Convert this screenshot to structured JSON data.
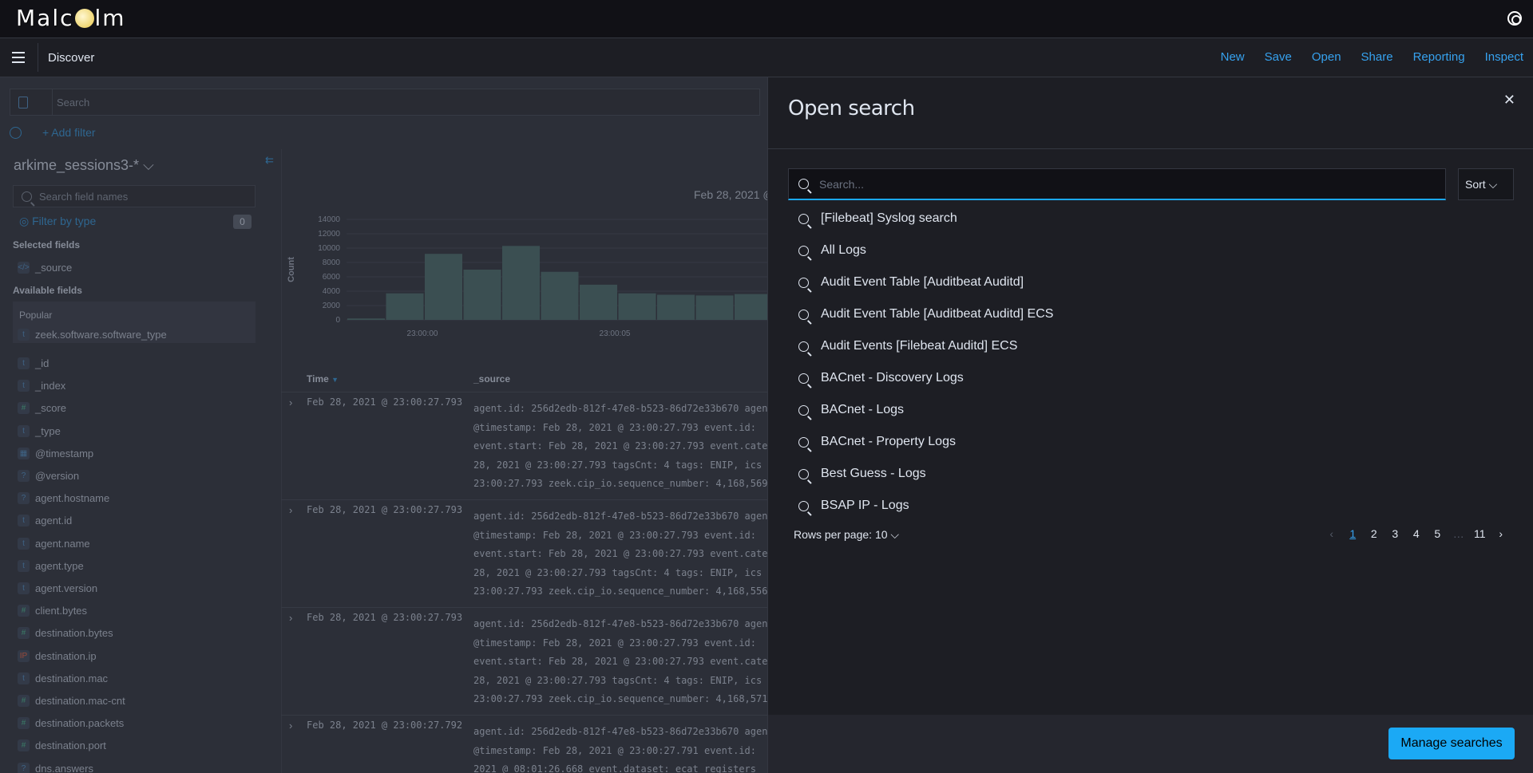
{
  "app": {
    "logo": "Malcolm",
    "breadcrumb": "Discover"
  },
  "toplinks": [
    "New",
    "Save",
    "Open",
    "Share",
    "Reporting",
    "Inspect"
  ],
  "discover": {
    "query_placeholder": "Search",
    "add_filter": "+ Add filter",
    "index_pattern": "arkime_sessions3-*",
    "field_search_placeholder": "Search field names",
    "filter_by_type": "Filter by type",
    "filter_count": "0",
    "selected_fields_label": "Selected fields",
    "selected_fields": [
      {
        "type": "</>",
        "name": "_source"
      }
    ],
    "available_fields_label": "Available fields",
    "popular_label": "Popular",
    "popular_fields": [
      {
        "type": "t",
        "name": "zeek.software.software_type"
      }
    ],
    "fields": [
      {
        "type": "t",
        "name": "_id"
      },
      {
        "type": "t",
        "name": "_index"
      },
      {
        "type": "#",
        "name": "_score"
      },
      {
        "type": "t",
        "name": "_type"
      },
      {
        "type": "▦",
        "name": "@timestamp"
      },
      {
        "type": "?",
        "name": "@version"
      },
      {
        "type": "?",
        "name": "agent.hostname"
      },
      {
        "type": "t",
        "name": "agent.id"
      },
      {
        "type": "t",
        "name": "agent.name"
      },
      {
        "type": "t",
        "name": "agent.type"
      },
      {
        "type": "t",
        "name": "agent.version"
      },
      {
        "type": "#",
        "name": "client.bytes"
      },
      {
        "type": "#",
        "name": "destination.bytes"
      },
      {
        "type": "IP",
        "name": "destination.ip"
      },
      {
        "type": "t",
        "name": "destination.mac"
      },
      {
        "type": "#",
        "name": "destination.mac-cnt"
      },
      {
        "type": "#",
        "name": "destination.packets"
      },
      {
        "type": "#",
        "name": "destination.port"
      },
      {
        "type": "?",
        "name": "dns.answers"
      }
    ],
    "histogram": {
      "date_label": "Feb 28, 2021 @",
      "ylabel": "Count",
      "yticks": [
        "14000",
        "12000",
        "10000",
        "8000",
        "6000",
        "4000",
        "2000",
        "0"
      ],
      "ymax": 14000,
      "xticks": [
        "23:00:00",
        "23:00:05"
      ],
      "values": [
        200,
        3700,
        9200,
        7000,
        10300,
        6700,
        4900,
        3700,
        3500,
        3400,
        3600
      ]
    },
    "table": {
      "columns": [
        "Time",
        "_source"
      ],
      "rows": [
        {
          "time": "Feb 28, 2021 @ 23:00:27.793",
          "lines": [
            "agent.id: 256d2edb-812f-47e8-b523-86d72e33b670  agent",
            "@timestamp: Feb 28, 2021 @ 23:00:27.793  event.id: ",
            "event.start: Feb 28, 2021 @ 23:00:27.793  event.cate",
            "28, 2021 @ 23:00:27.793  tagsCnt: 4  tags: ENIP, ics",
            "23:00:27.793  zeek.cip_io.sequence_number: 4,168,569"
          ]
        },
        {
          "time": "Feb 28, 2021 @ 23:00:27.793",
          "lines": [
            "agent.id: 256d2edb-812f-47e8-b523-86d72e33b670  agent",
            "@timestamp: Feb 28, 2021 @ 23:00:27.793  event.id: ",
            "event.start: Feb 28, 2021 @ 23:00:27.793  event.cate",
            "28, 2021 @ 23:00:27.793  tagsCnt: 4  tags: ENIP, ics",
            "23:00:27.793  zeek.cip_io.sequence_number: 4,168,556"
          ]
        },
        {
          "time": "Feb 28, 2021 @ 23:00:27.793",
          "lines": [
            "agent.id: 256d2edb-812f-47e8-b523-86d72e33b670  agent",
            "@timestamp: Feb 28, 2021 @ 23:00:27.793  event.id: ",
            "event.start: Feb 28, 2021 @ 23:00:27.793  event.cate",
            "28, 2021 @ 23:00:27.793  tagsCnt: 4  tags: ENIP, ics",
            "23:00:27.793  zeek.cip_io.sequence_number: 4,168,571"
          ]
        },
        {
          "time": "Feb 28, 2021 @ 23:00:27.792",
          "lines": [
            "agent.id: 256d2edb-812f-47e8-b523-86d72e33b670  agent",
            "@timestamp: Feb 28, 2021 @ 23:00:27.791  event.id: ",
            "2021 @ 08:01:26.668  event.dataset: ecat_registers"
          ]
        }
      ]
    }
  },
  "flyout": {
    "title": "Open search",
    "search_placeholder": "Search...",
    "sort_label": "Sort",
    "items": [
      "[Filebeat] Syslog search",
      "All Logs",
      "Audit Event Table [Auditbeat Auditd]",
      "Audit Event Table [Auditbeat Auditd] ECS",
      "Audit Events [Filebeat Auditd] ECS",
      "BACnet - Discovery Logs",
      "BACnet - Logs",
      "BACnet - Property Logs",
      "Best Guess - Logs",
      "BSAP IP - Logs"
    ],
    "rows_per_page": "Rows per page: 10",
    "pages": [
      "1",
      "2",
      "3",
      "4",
      "5",
      "…",
      "11"
    ],
    "current_page": "1",
    "manage_label": "Manage searches"
  },
  "colors": {
    "accent": "#36a2ef",
    "primary_button": "#1ba9f5",
    "bar": "#54b399"
  }
}
